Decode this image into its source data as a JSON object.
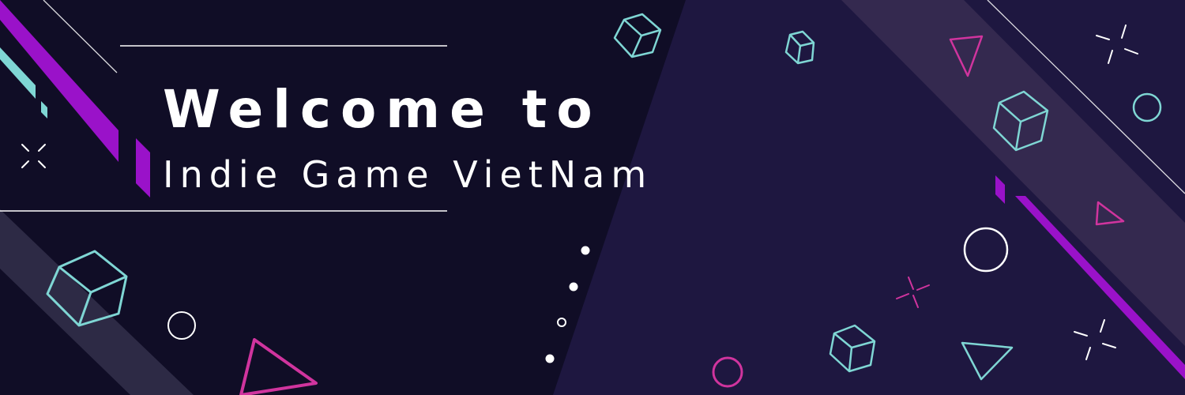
{
  "banner": {
    "title_line1": "Welcome to",
    "title_line2": "Indie Game VietNam"
  },
  "colors": {
    "background_left": "#100d26",
    "background_right": "#1e1740",
    "stripe_band": "#34294f",
    "purple_accent": "#9a12c9",
    "cyan_accent": "#7fd6d4",
    "pink_accent": "#d0349e",
    "text": "#ffffff"
  },
  "decorations": [
    "cube-icon",
    "triangle-icon",
    "circle-icon",
    "sparkle-icon",
    "dot",
    "diagonal-stripe"
  ]
}
